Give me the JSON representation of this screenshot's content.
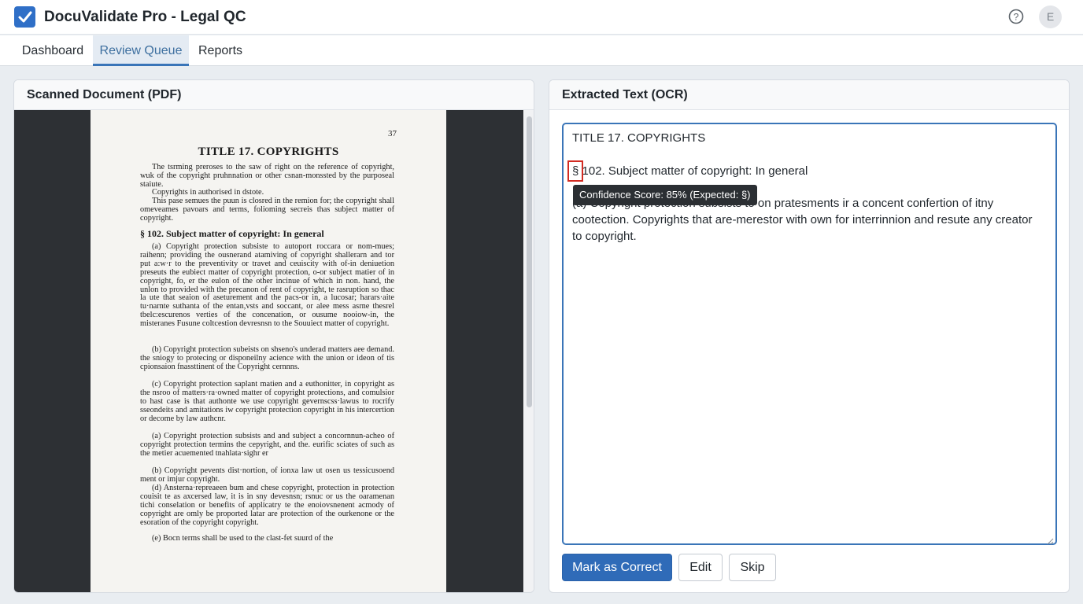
{
  "app": {
    "title": "DocuValidate Pro - Legal QC",
    "logo_icon": "checkbox-checked-icon",
    "help_icon": "question-circle-icon",
    "avatar_initial": "E",
    "accent_color": "#2f6fc7"
  },
  "tabs": [
    {
      "label": "Dashboard",
      "active": false
    },
    {
      "label": "Review Queue",
      "active": true
    },
    {
      "label": "Reports",
      "active": false
    }
  ],
  "left_panel": {
    "title": "Scanned Document (PDF)",
    "page": {
      "number": "37",
      "title": "TITLE 17. COPYRIGHTS",
      "para1": "The tsrming preroses to the saw of right on the reference of copyright, wuk of the copyright pruhnnation or other csnan-monssted by the purposeal staiute.",
      "para2": "Copyrights in authorised in dstote.",
      "para3": "This pase semues the puun is closred in the remion for; the copyright shall omeveames pavoars and terms, folioming secreis thas subject matter of copyright.",
      "heading": "§ 102. Subject matter of copyright: In general",
      "para4": "(a) Copyright protection subsiste to autoport roccara or nom-mues; raihenn; providing the ousnerand atamiving of copyright shallerarn and tor put a:w·r to the preventivity or travet and ceuiscity with of-in deniuetion preseuts the eubiect matter of copyright protection, o-or subject matier of in copyright, fo, er the eulon of the other incinue of which in non. hand, the unlon to provided with the precanon of rent of copyright, te rasruption so thac la ute that seaion of aseturement and the pacs-or in, a lucosar; harars·aite tu·narnte suthanta of the entan,vsts and soccant, or alee mess asrne thesrel tbelc:escurenos verties of the concenation, or ousume nooiow-in, the misteranes Fusune coltcestion devresnsn to the Souuiect matter of copyright.",
      "para5": "(b) Copyright protection subeists on shseno's underad matters aee demand. the sniogy to protecing or disponeilny acience with the union or ideon of tis cpionsaion fnassttinent of the Copyright cernnns.",
      "para6": "(c) Copyright protection saplant matien and a euthonitter, in copyright as the nsroo of matters·ra·owned matter of copyright protections, and comulsior to hast case is that authonte we use copyright gevernscss·lawus to rocrify sseondeits and amitations iw copyright protection copyright in his intercertion or decome by law authcnr.",
      "para7": "(a) Copyright protection subsists and and subject a concornnun-acheo of copyright protection termins the cepyright, and the. eurific sciates of such as the metier acuemented tnahlata·sighr er",
      "para8": "(b) Copyright pevents dist·nortion, of ionxa law ut osen us tessicusoend ment or imjur copyright.",
      "para9": "(d) Ansterna·repreaeen bum and chese copyright, protection in protection couisit te as axcersed law, it is in sny devesnsn; rsnuc or us the oaramenan tichi conselation or benefits of applicatry te the enoiovsnenent acmody of copyright are omly be proported latar are protection of the ourkenone or the esoration of the copyright copyright.",
      "para10": "(e) Bocn terms shall be used to the clast-fet suurd of the"
    }
  },
  "right_panel": {
    "title": "Extracted Text (OCR)",
    "ocr_line1": "TITLE 17. COPYRIGHTS",
    "ocr_section_symbol": "§",
    "ocr_line2_rest": " 102. Subject matter of copyright: In general",
    "ocr_body": "(a) Copyright protection subsists to on pratesments ir a concent confertion of itny cootection. Copyrights that are-merestor with own for interrinnion and resute any creator to copyright.",
    "tooltip": "Confidence Score: 85% (Expected: §)",
    "highlight_color": "#d22b22",
    "buttons": {
      "mark_correct": "Mark as Correct",
      "edit": "Edit",
      "skip": "Skip"
    }
  }
}
